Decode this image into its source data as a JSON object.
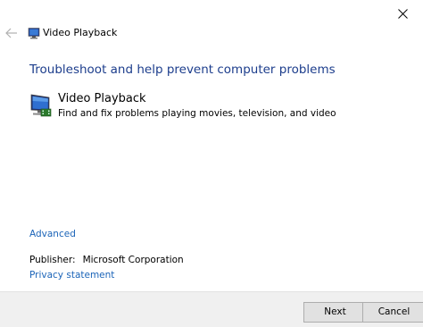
{
  "window": {
    "title": "Video Playback",
    "close_icon": "close-icon",
    "back_icon": "back-arrow-icon"
  },
  "main": {
    "heading": "Troubleshoot and help prevent computer problems",
    "troubleshooter": {
      "name": "Video Playback",
      "description": "Find and fix problems playing movies, television, and video",
      "icon": "monitor-video-icon"
    },
    "advanced_link": "Advanced",
    "publisher_label": "Publisher:",
    "publisher_value": "Microsoft Corporation",
    "privacy_link": "Privacy statement"
  },
  "footer": {
    "next_label": "Next",
    "cancel_label": "Cancel"
  },
  "colors": {
    "heading": "#1c3d8c",
    "link": "#1b64b8",
    "footer_bg": "#f0f0f0"
  }
}
